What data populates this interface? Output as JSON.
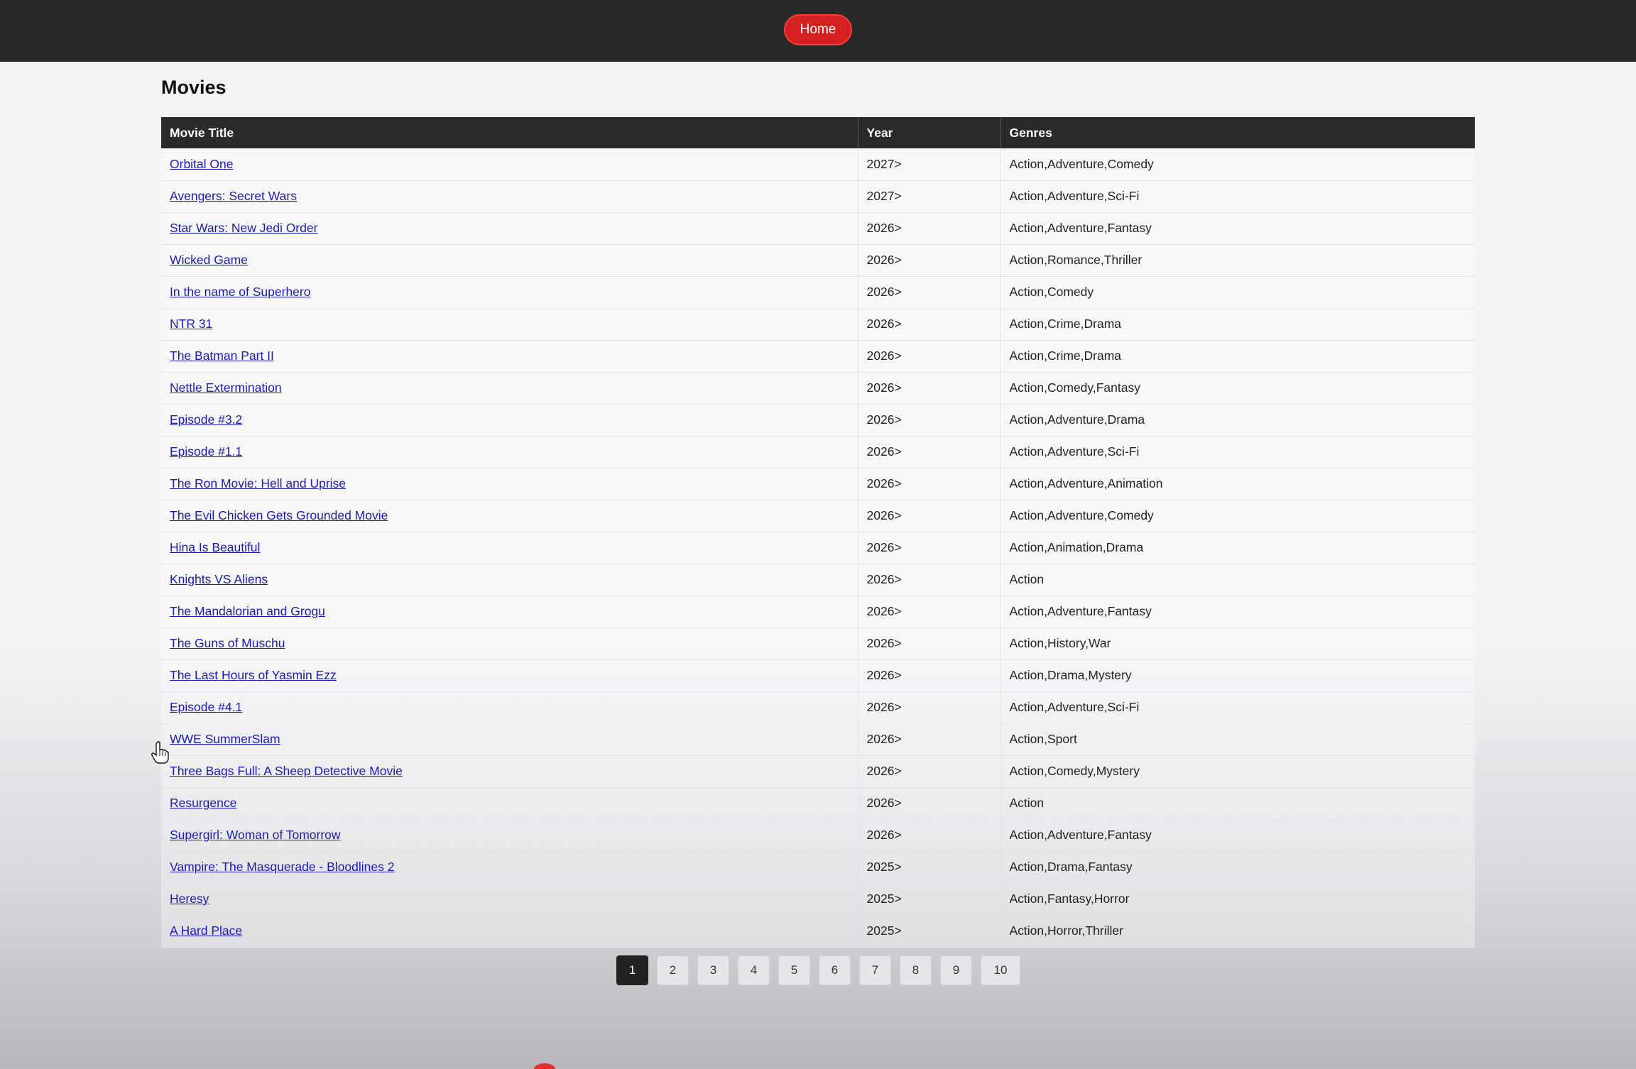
{
  "nav": {
    "home_label": "Home"
  },
  "page": {
    "title": "Movies"
  },
  "table": {
    "headers": {
      "title": "Movie Title",
      "year": "Year",
      "genres": "Genres"
    },
    "rows": [
      {
        "title": "Orbital One",
        "year": "2027>",
        "genres": "Action,Adventure,Comedy"
      },
      {
        "title": "Avengers: Secret Wars",
        "year": "2027>",
        "genres": "Action,Adventure,Sci-Fi"
      },
      {
        "title": "Star Wars: New Jedi Order",
        "year": "2026>",
        "genres": "Action,Adventure,Fantasy"
      },
      {
        "title": "Wicked Game",
        "year": "2026>",
        "genres": "Action,Romance,Thriller"
      },
      {
        "title": "In the name of Superhero",
        "year": "2026>",
        "genres": "Action,Comedy"
      },
      {
        "title": "NTR 31",
        "year": "2026>",
        "genres": "Action,Crime,Drama"
      },
      {
        "title": "The Batman Part II",
        "year": "2026>",
        "genres": "Action,Crime,Drama"
      },
      {
        "title": "Nettle Extermination",
        "year": "2026>",
        "genres": "Action,Comedy,Fantasy"
      },
      {
        "title": "Episode #3.2",
        "year": "2026>",
        "genres": "Action,Adventure,Drama"
      },
      {
        "title": "Episode #1.1",
        "year": "2026>",
        "genres": "Action,Adventure,Sci-Fi"
      },
      {
        "title": "The Ron Movie: Hell and Uprise",
        "year": "2026>",
        "genres": "Action,Adventure,Animation"
      },
      {
        "title": "The Evil Chicken Gets Grounded Movie",
        "year": "2026>",
        "genres": "Action,Adventure,Comedy"
      },
      {
        "title": "Hina Is Beautiful",
        "year": "2026>",
        "genres": "Action,Animation,Drama"
      },
      {
        "title": "Knights VS Aliens",
        "year": "2026>",
        "genres": "Action"
      },
      {
        "title": "The Mandalorian and Grogu",
        "year": "2026>",
        "genres": "Action,Adventure,Fantasy"
      },
      {
        "title": "The Guns of Muschu",
        "year": "2026>",
        "genres": "Action,History,War"
      },
      {
        "title": "The Last Hours of Yasmin Ezz",
        "year": "2026>",
        "genres": "Action,Drama,Mystery"
      },
      {
        "title": "Episode #4.1",
        "year": "2026>",
        "genres": "Action,Adventure,Sci-Fi"
      },
      {
        "title": "WWE SummerSlam",
        "year": "2026>",
        "genres": "Action,Sport"
      },
      {
        "title": "Three Bags Full: A Sheep Detective Movie",
        "year": "2026>",
        "genres": "Action,Comedy,Mystery"
      },
      {
        "title": "Resurgence",
        "year": "2026>",
        "genres": "Action"
      },
      {
        "title": "Supergirl: Woman of Tomorrow",
        "year": "2026>",
        "genres": "Action,Adventure,Fantasy"
      },
      {
        "title": "Vampire: The Masquerade - Bloodlines 2",
        "year": "2025>",
        "genres": "Action,Drama,Fantasy"
      },
      {
        "title": "Heresy",
        "year": "2025>",
        "genres": "Action,Fantasy,Horror"
      },
      {
        "title": "A Hard Place",
        "year": "2025>",
        "genres": "Action,Horror,Thriller"
      }
    ]
  },
  "pagination": {
    "pages": [
      "1",
      "2",
      "3",
      "4",
      "5",
      "6",
      "7",
      "8",
      "9",
      "10"
    ],
    "active": "1"
  },
  "colors": {
    "header_bg": "#282828",
    "home_button": "#d42020",
    "link": "#1a1ab8"
  },
  "icons": {
    "cursor": "hand-pointer-icon"
  }
}
